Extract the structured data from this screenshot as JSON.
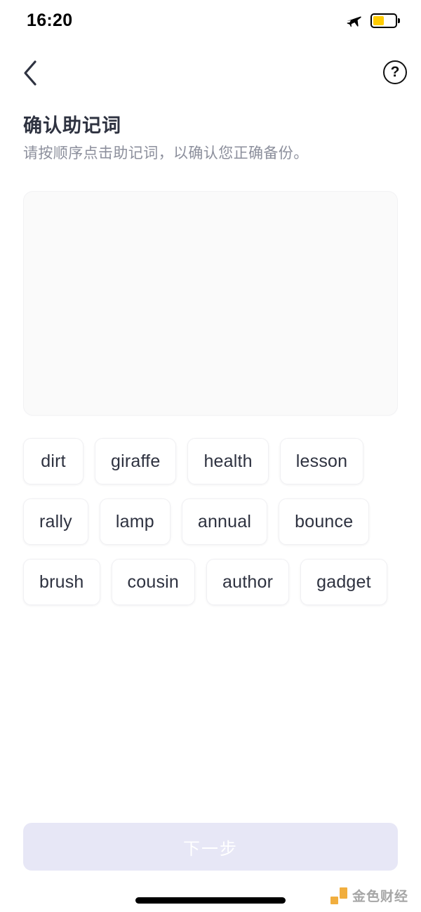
{
  "status_bar": {
    "time": "16:20",
    "airplane_icon": "airplane-mode-icon",
    "battery_icon": "battery-low-power-icon",
    "battery_level_percent": 50,
    "battery_fill_color": "#ffcc00"
  },
  "nav": {
    "back_icon": "chevron-left-icon",
    "help_icon": "question-mark-circle-icon",
    "help_glyph": "?"
  },
  "header": {
    "title": "确认助记词",
    "subtitle": "请按顺序点击助记词，以确认您正确备份。"
  },
  "selected_area": {
    "name": "selected-mnemonic-dropzone",
    "selected_words": [],
    "background_color": "#fafafa"
  },
  "word_bank": {
    "words": [
      "dirt",
      "giraffe",
      "health",
      "lesson",
      "rally",
      "lamp",
      "annual",
      "bounce",
      "brush",
      "cousin",
      "author",
      "gadget"
    ]
  },
  "footer": {
    "next_label": "下一步",
    "next_enabled": false,
    "next_bg_color": "#e7e7f6",
    "next_text_color": "#ffffff"
  },
  "watermark": {
    "text": "金色财经",
    "logo_color": "#f0a324"
  }
}
